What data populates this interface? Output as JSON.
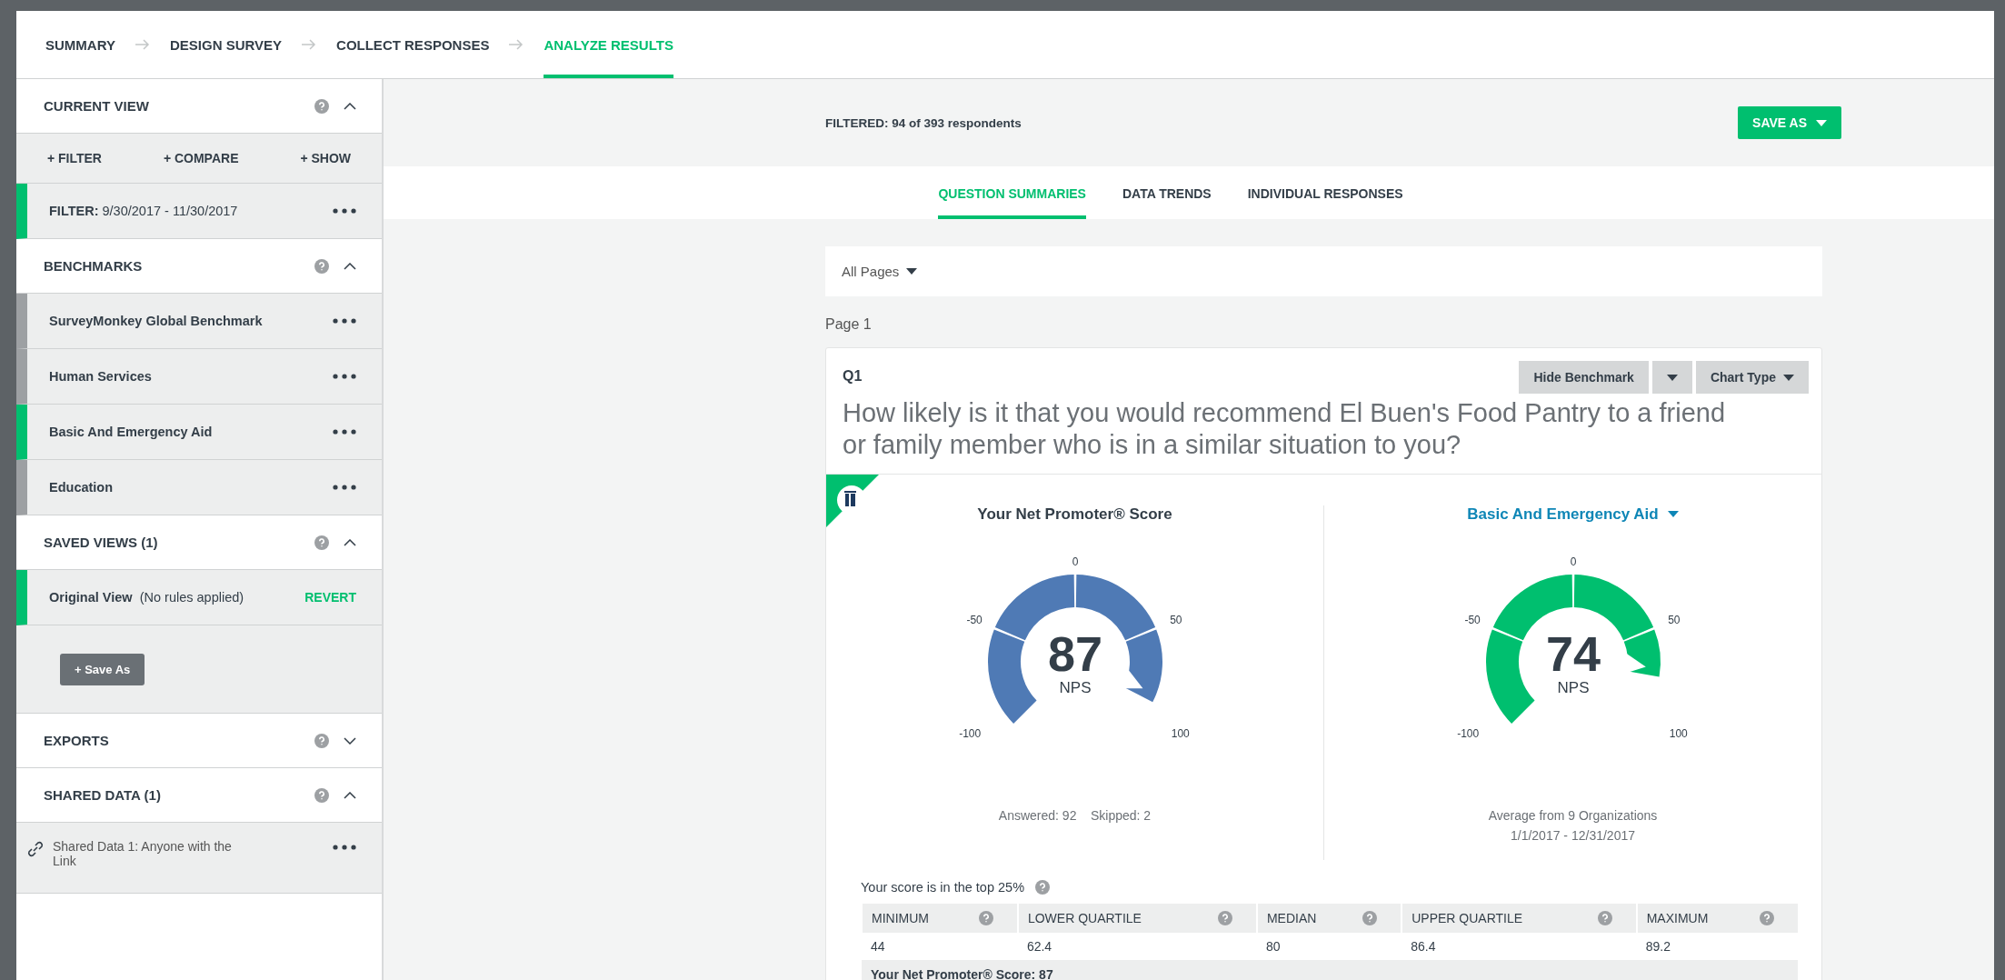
{
  "steps": [
    {
      "label": "SUMMARY",
      "selected": false
    },
    {
      "label": "DESIGN SURVEY",
      "selected": false
    },
    {
      "label": "COLLECT RESPONSES",
      "selected": false
    },
    {
      "label": "ANALYZE RESULTS",
      "selected": true
    }
  ],
  "sidebar": {
    "sections": [
      {
        "kind": "current",
        "title": "CURRENT VIEW",
        "expanded": true,
        "actions": [
          "+ FILTER",
          "+ COMPARE",
          "+ SHOW"
        ],
        "items": [
          {
            "label": "FILTER:",
            "detail": "9/30/2017 - 11/30/2017",
            "selected": true
          }
        ]
      },
      {
        "kind": "list",
        "title": "BENCHMARKS",
        "expanded": true,
        "items": [
          {
            "label": "SurveyMonkey Global Benchmark",
            "selected": false
          },
          {
            "label": "Human Services",
            "selected": false
          },
          {
            "label": "Basic And Emergency Aid",
            "selected": true
          },
          {
            "label": "Education",
            "selected": false
          }
        ]
      },
      {
        "kind": "saved",
        "title": "SAVED VIEWS (1)",
        "expanded": true,
        "items": [
          {
            "label": "Original View",
            "detail": "(No rules applied)",
            "action": "REVERT",
            "selected": true
          }
        ],
        "button": "+ Save As"
      },
      {
        "title": "EXPORTS",
        "expanded": false
      },
      {
        "kind": "shared",
        "title": "SHARED DATA (1)",
        "expanded": true,
        "items": [
          {
            "label": "Shared Data 1: Anyone with the Link"
          }
        ]
      }
    ]
  },
  "filter_status": "FILTERED: 94 of 393 respondents",
  "save_as": "SAVE AS",
  "tabs": [
    {
      "label": "QUESTION SUMMARIES",
      "selected": true
    },
    {
      "label": "DATA TRENDS",
      "selected": false
    },
    {
      "label": "INDIVIDUAL RESPONSES",
      "selected": false
    }
  ],
  "page_select": "All Pages",
  "page_label": "Page 1",
  "question": {
    "number": "Q1",
    "buttons": [
      "Hide Benchmark",
      "Chart Type"
    ],
    "text": "How likely is it that you would recommend El Buen's Food Pantry to a friend or family member who is in a similar situation to you?",
    "gauges": [
      {
        "title": "Your Net Promoter® Score",
        "dropdown": false,
        "score": "87",
        "unit": "NPS",
        "color": "#4f7ab5",
        "ticks": [
          "-100",
          "-50",
          "0",
          "50",
          "100"
        ],
        "notes": [
          "Answered: 92    Skipped: 2"
        ]
      },
      {
        "title": "Basic And Emergency Aid",
        "dropdown": true,
        "score": "74",
        "unit": "NPS",
        "color": "#00bf6f",
        "ticks": [
          "-100",
          "-50",
          "0",
          "50",
          "100"
        ],
        "notes": [
          "Average from 9 Organizations",
          "1/1/2017 - 12/31/2017"
        ]
      }
    ],
    "rank": "Your score is in the top 25%",
    "stats": {
      "columns": [
        "MINIMUM",
        "LOWER QUARTILE",
        "MEDIAN",
        "UPPER QUARTILE",
        "MAXIMUM"
      ],
      "values": [
        "44",
        "62.4",
        "80",
        "86.4",
        "89.2"
      ],
      "footer": "Your Net Promoter® Score: 87"
    }
  }
}
